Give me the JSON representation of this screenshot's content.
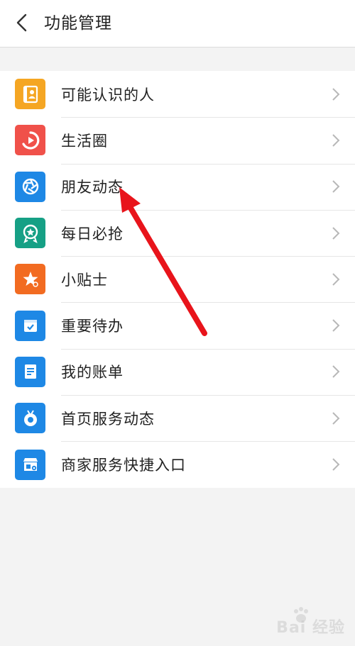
{
  "header": {
    "title": "功能管理"
  },
  "list": {
    "items": [
      {
        "label": "可能认识的人",
        "icon": "contacts-book-icon",
        "color": "#f5a623"
      },
      {
        "label": "生活圈",
        "icon": "life-circle-icon",
        "color": "#f0514a"
      },
      {
        "label": "朋友动态",
        "icon": "shutter-icon",
        "color": "#1e88e5"
      },
      {
        "label": "每日必抢",
        "icon": "medal-icon",
        "color": "#16a085"
      },
      {
        "label": "小贴士",
        "icon": "star-tip-icon",
        "color": "#f26b21"
      },
      {
        "label": "重要待办",
        "icon": "calendar-check-icon",
        "color": "#1e88e5"
      },
      {
        "label": "我的账单",
        "icon": "bill-icon",
        "color": "#1e88e5"
      },
      {
        "label": "首页服务动态",
        "icon": "tv-ring-icon",
        "color": "#1e88e5"
      },
      {
        "label": "商家服务快捷入口",
        "icon": "shop-icon",
        "color": "#1e88e5"
      }
    ]
  },
  "annotation": {
    "arrow_color": "#e8141b"
  },
  "watermark": {
    "text": "Bai 经验"
  }
}
